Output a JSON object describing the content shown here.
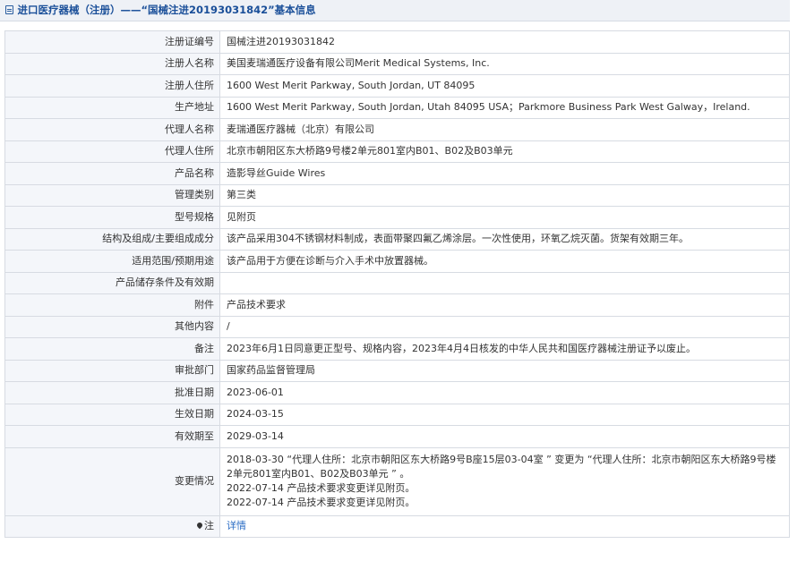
{
  "header": {
    "title": "进口医疗器械（注册）——“国械注进20193031842”基本信息"
  },
  "rows": [
    {
      "label": "注册证编号",
      "value": "国械注进20193031842"
    },
    {
      "label": "注册人名称",
      "value": "美国麦瑞通医疗设备有限公司Merit Medical Systems, Inc."
    },
    {
      "label": "注册人住所",
      "value": "1600 West Merit Parkway, South Jordan, UT 84095"
    },
    {
      "label": "生产地址",
      "value": "1600 West Merit Parkway, South Jordan, Utah 84095 USA；Parkmore Business Park West Galway，Ireland."
    },
    {
      "label": "代理人名称",
      "value": "麦瑞通医疗器械（北京）有限公司"
    },
    {
      "label": "代理人住所",
      "value": "北京市朝阳区东大桥路9号楼2单元801室内B01、B02及B03单元"
    },
    {
      "label": "产品名称",
      "value": "造影导丝Guide Wires"
    },
    {
      "label": "管理类别",
      "value": "第三类"
    },
    {
      "label": "型号规格",
      "value": "见附页"
    },
    {
      "label": "结构及组成/主要组成成分",
      "value": "该产品采用304不锈钢材料制成，表面带聚四氟乙烯涂层。一次性使用，环氧乙烷灭菌。货架有效期三年。"
    },
    {
      "label": "适用范围/预期用途",
      "value": "该产品用于方便在诊断与介入手术中放置器械。"
    },
    {
      "label": "产品储存条件及有效期",
      "value": ""
    },
    {
      "label": "附件",
      "value": "产品技术要求"
    },
    {
      "label": "其他内容",
      "value": "/"
    },
    {
      "label": "备注",
      "value": "2023年6月1日同意更正型号、规格内容，2023年4月4日核发的中华人民共和国医疗器械注册证予以废止。"
    },
    {
      "label": "审批部门",
      "value": "国家药品监督管理局"
    },
    {
      "label": "批准日期",
      "value": "2023-06-01"
    },
    {
      "label": "生效日期",
      "value": "2024-03-15"
    },
    {
      "label": "有效期至",
      "value": "2029-03-14"
    }
  ],
  "change_history": {
    "label": "变更情况",
    "lines": [
      "2018-03-30 “代理人住所：北京市朝阳区东大桥路9号B座15层03-04室 ” 变更为 “代理人住所：北京市朝阳区东大桥路9号楼2单元801室内B01、B02及B03单元 ” 。",
      "2022-07-14 产品技术要求变更详见附页。",
      "2022-07-14 产品技术要求变更详见附页。"
    ]
  },
  "note": {
    "label": "注",
    "icon": "pin-icon",
    "link_text": "详情",
    "link_color": "#2a6cc4"
  }
}
